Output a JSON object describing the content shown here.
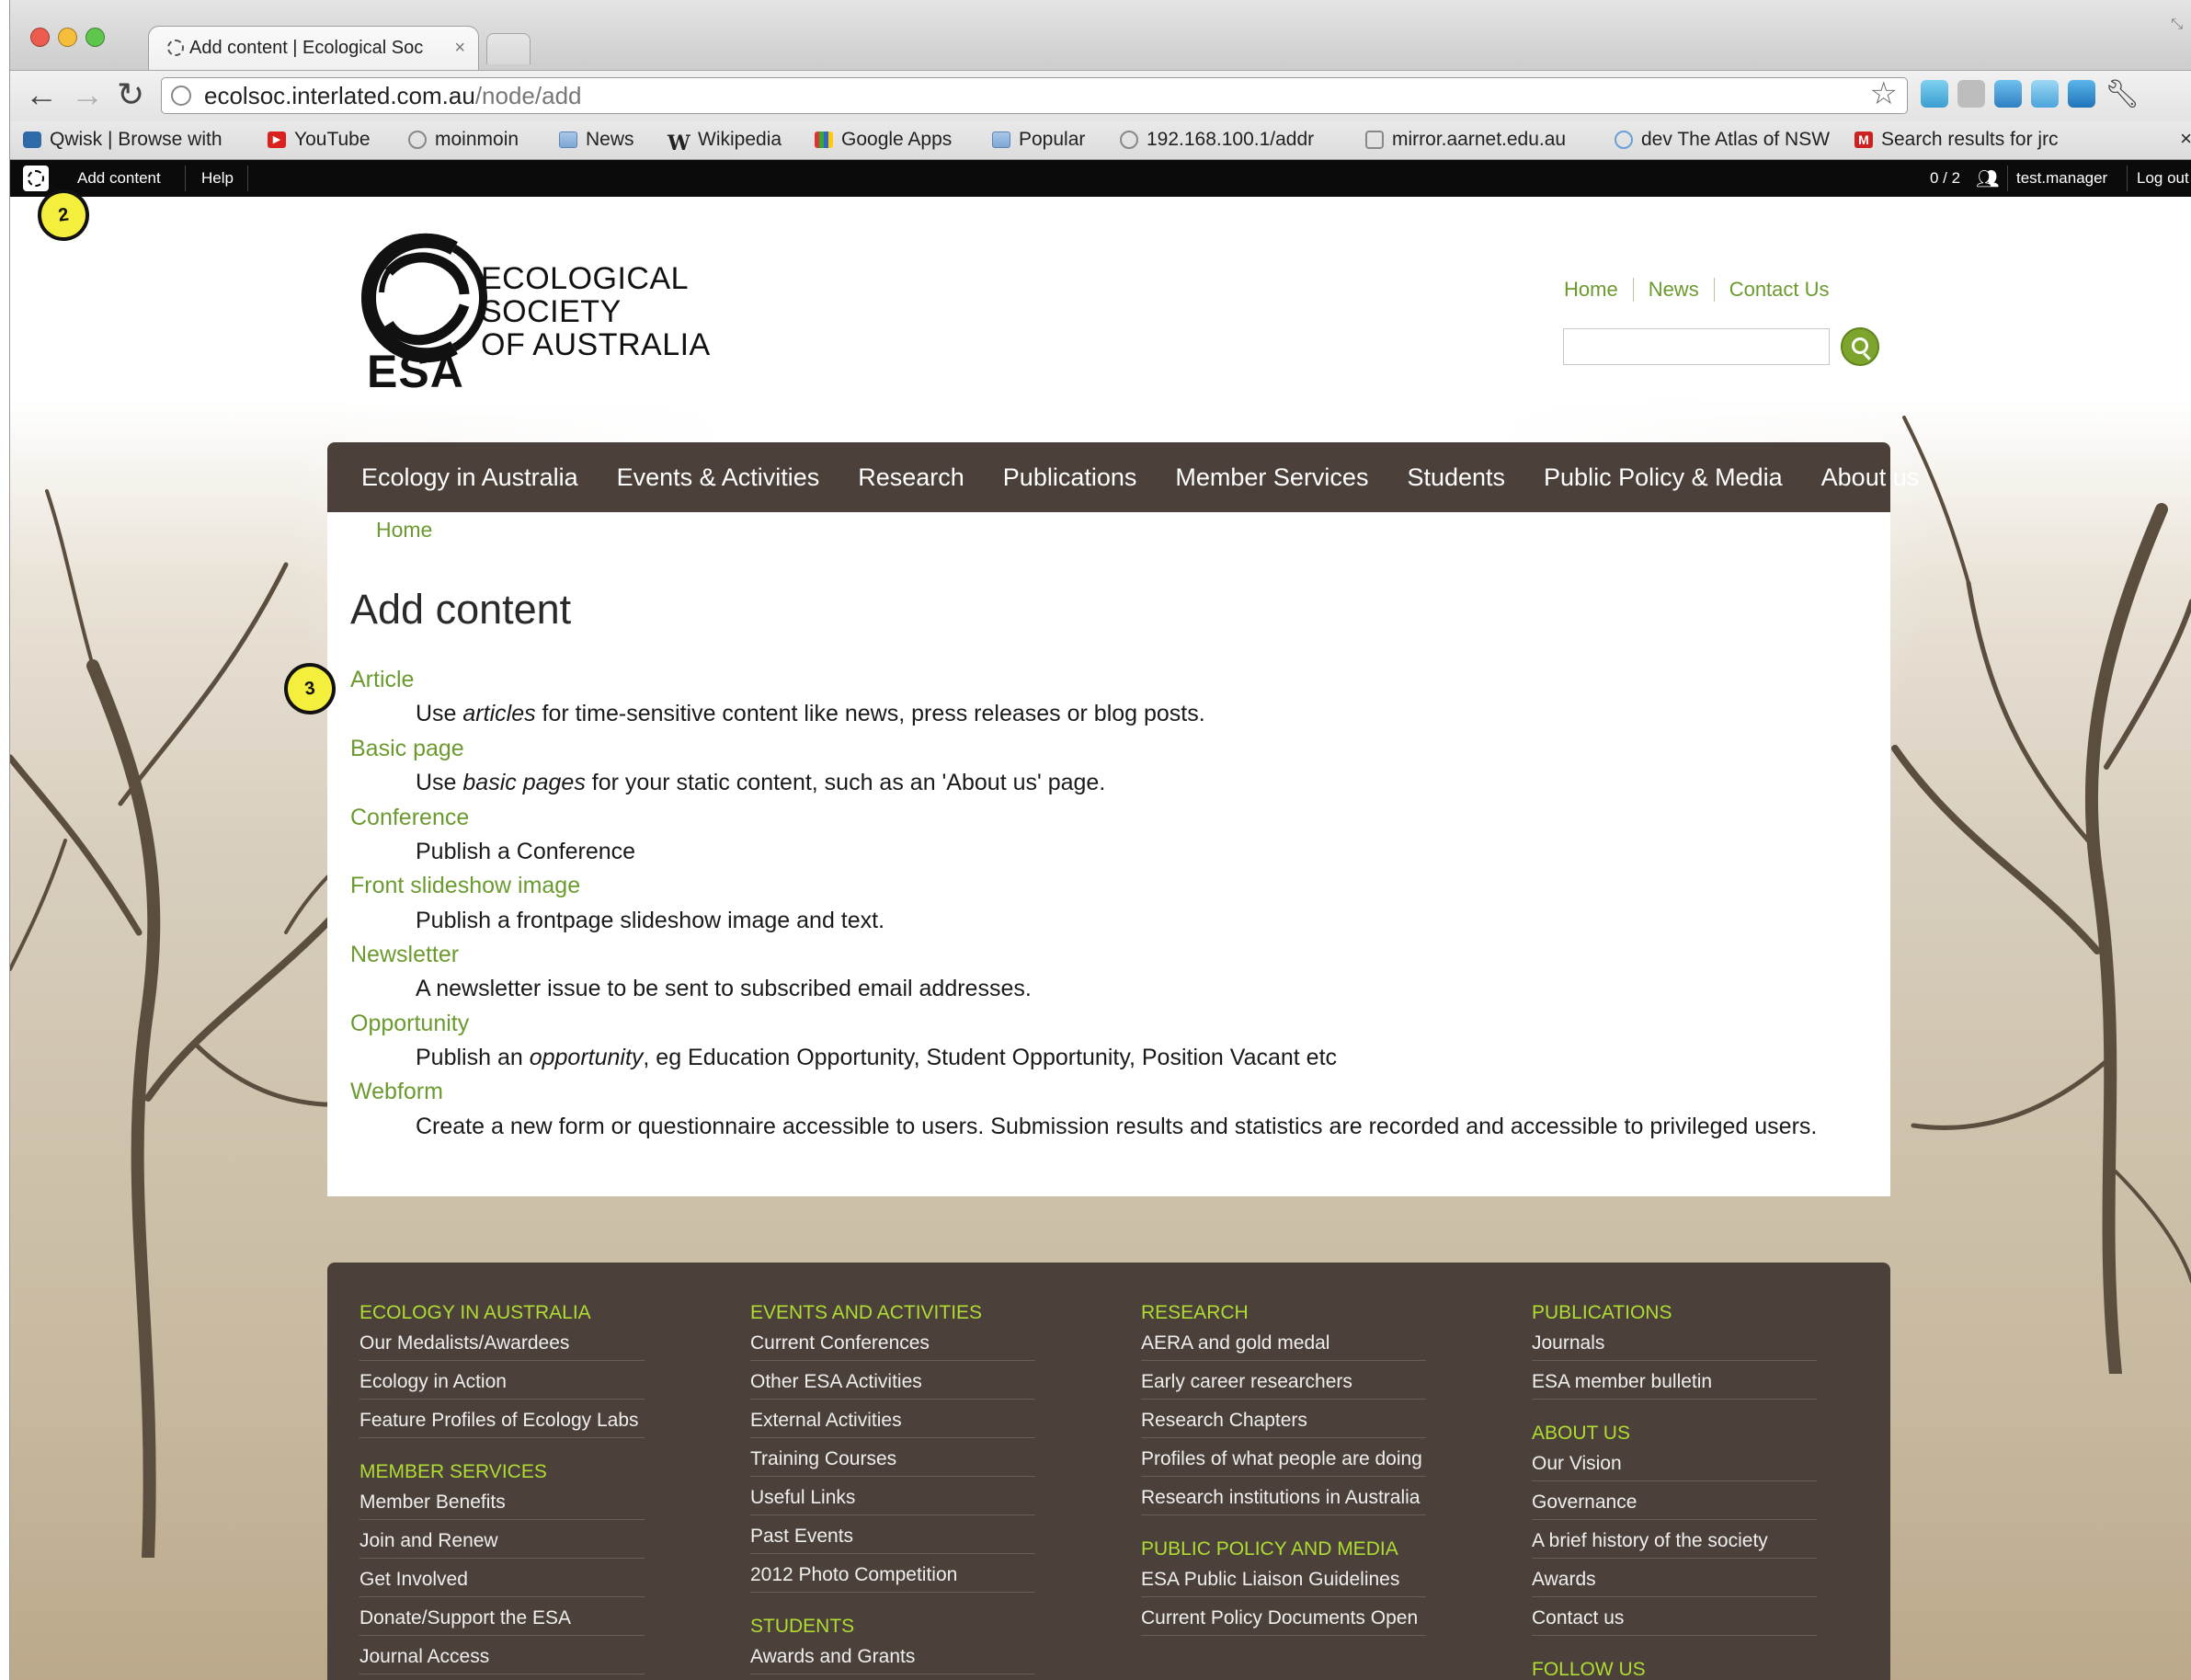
{
  "browser": {
    "tab_title": "Add content | Ecological Soc",
    "url_domain": "ecolsoc.interlated.com.au",
    "url_path": "/node/add",
    "bookmarks": [
      {
        "label": "Qwisk | Browse with",
        "icon": "qwisk-icon"
      },
      {
        "label": "YouTube",
        "icon": "youtube-icon"
      },
      {
        "label": "moinmoin",
        "icon": "globe-icon"
      },
      {
        "label": "News",
        "icon": "folder-icon"
      },
      {
        "label": "Wikipedia",
        "icon": "wikipedia-icon"
      },
      {
        "label": "Google Apps",
        "icon": "google-apps-icon"
      },
      {
        "label": "Popular",
        "icon": "folder-icon"
      },
      {
        "label": "192.168.100.1/addr",
        "icon": "globe-icon"
      },
      {
        "label": "mirror.aarnet.edu.au",
        "icon": "mirror-icon"
      },
      {
        "label": "dev The Atlas of NSW",
        "icon": "atlas-icon"
      },
      {
        "label": "Search results for jrc",
        "icon": "gmail-icon"
      }
    ],
    "bookmarks_close": "×"
  },
  "admin_bar": {
    "add_content": "Add content",
    "help": "Help",
    "users_count": "0 / 2",
    "username": "test.manager",
    "logout": "Log out"
  },
  "site": {
    "logo_line1": "ECOLOGICAL",
    "logo_line2": "SOCIETY",
    "logo_line3": "OF AUSTRALIA",
    "logo_abbr": "ESA",
    "top_links": [
      "Home",
      "News",
      "Contact Us"
    ],
    "accent_color": "#6b9a2e",
    "nav_bg_color": "#4b413a",
    "main_nav": [
      "Ecology in Australia",
      "Events & Activities",
      "Research",
      "Publications",
      "Member Services",
      "Students",
      "Public Policy & Media",
      "About us"
    ]
  },
  "content": {
    "breadcrumb": "Home",
    "title": "Add content",
    "types": [
      {
        "name": "Article",
        "pre": "Use ",
        "em": "articles",
        "post": " for time-sensitive content like news, press releases or blog posts."
      },
      {
        "name": "Basic page",
        "pre": "Use ",
        "em": "basic pages",
        "post": " for your static content, such as an 'About us' page."
      },
      {
        "name": "Conference",
        "pre": "Publish a Conference",
        "em": "",
        "post": ""
      },
      {
        "name": "Front slideshow image",
        "pre": "Publish a frontpage slideshow image and text.",
        "em": "",
        "post": ""
      },
      {
        "name": "Newsletter",
        "pre": "A newsletter issue to be sent to subscribed email addresses.",
        "em": "",
        "post": ""
      },
      {
        "name": "Opportunity",
        "pre": "Publish an ",
        "em": "opportunity",
        "post": ", eg Education Opportunity, Student Opportunity, Position Vacant etc"
      },
      {
        "name": "Webform",
        "pre": "Create a new form or questionnaire accessible to users. Submission results and statistics are recorded and accessible to privileged users.",
        "em": "",
        "post": ""
      }
    ]
  },
  "footer": {
    "columns": [
      {
        "sections": [
          {
            "heading": "ECOLOGY IN AUSTRALIA",
            "links": [
              "Our Medalists/Awardees",
              "Ecology in Action",
              "Feature Profiles of Ecology Labs"
            ]
          },
          {
            "heading": "MEMBER SERVICES",
            "links": [
              "Member Benefits",
              "Join and Renew",
              "Get Involved",
              "Donate/Support the ESA",
              "Journal Access"
            ]
          }
        ]
      },
      {
        "sections": [
          {
            "heading": "EVENTS AND ACTIVITIES",
            "links": [
              "Current Conferences",
              "Other ESA Activities",
              "External Activities",
              "Training Courses",
              "Useful Links",
              "Past Events",
              "2012 Photo Competition"
            ]
          },
          {
            "heading": "STUDENTS",
            "links": [
              "Awards and Grants"
            ]
          }
        ]
      },
      {
        "sections": [
          {
            "heading": "RESEARCH",
            "links": [
              "AERA and gold medal",
              "Early career researchers",
              "Research Chapters",
              "Profiles of what people are doing",
              "Research institutions in Australia"
            ]
          },
          {
            "heading": "PUBLIC POLICY AND MEDIA",
            "links": [
              "ESA Public Liaison Guidelines",
              "Current Policy Documents Open"
            ]
          }
        ]
      },
      {
        "sections": [
          {
            "heading": "PUBLICATIONS",
            "links": [
              "Journals",
              "ESA member bulletin"
            ]
          },
          {
            "heading": "ABOUT US",
            "links": [
              "Our Vision",
              "Governance",
              "A brief history of the society",
              "Awards",
              "Contact us"
            ]
          },
          {
            "heading": "FOLLOW US",
            "links": []
          }
        ]
      }
    ]
  },
  "callouts": [
    "2",
    "3"
  ]
}
